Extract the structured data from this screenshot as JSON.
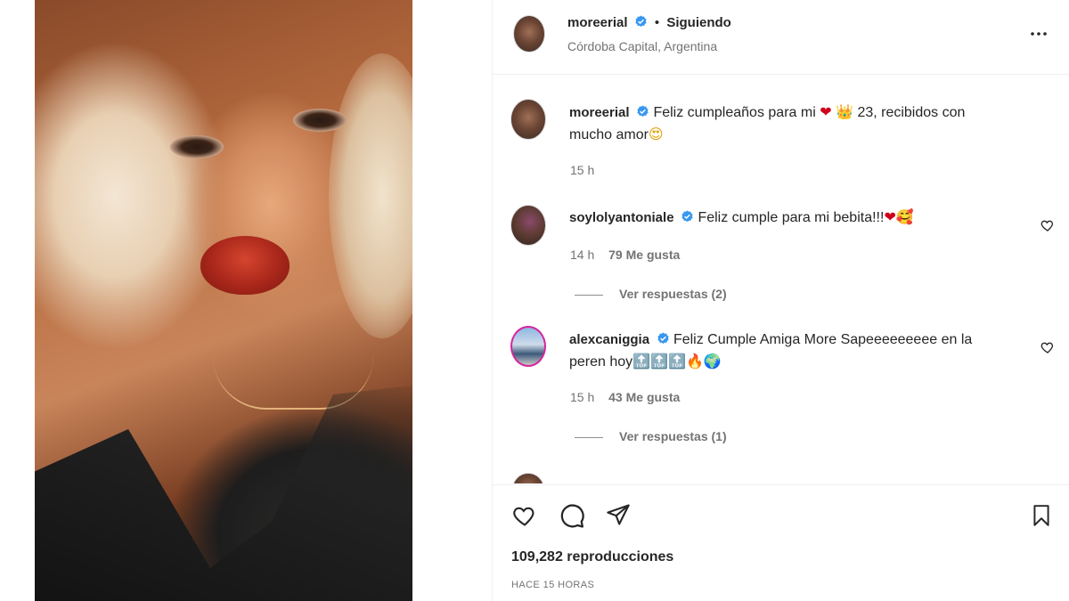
{
  "post": {
    "author": "moreerial",
    "follow_label": "Siguiendo",
    "follow_dot": "•",
    "location": "Córdoba Capital, Argentina",
    "more_label": "•••"
  },
  "caption": {
    "user": "moreerial",
    "text": "Feliz cumpleaños para mi",
    "emoji_1": "❤",
    "emoji_2": "👑",
    "text_2": "23, recibidos con",
    "text_3": "mucho amor",
    "emoji_3": "😍",
    "time": "15 h"
  },
  "comments": [
    {
      "user": "soylolyantoniale",
      "text": "Feliz cumple para mi bebita!!!",
      "emoji": "❤🥰",
      "time": "14 h",
      "likes": "79 Me gusta",
      "replies": "Ver respuestas (2)"
    },
    {
      "user": "alexcaniggia",
      "text": "Feliz Cumple Amiga More Sapeeeeeeeee en la",
      "text_2": "peren hoy",
      "emoji": "🔝🔝🔝🔥🌍",
      "time": "15 h",
      "likes": "43 Me gusta",
      "replies": "Ver respuestas (1)"
    }
  ],
  "stats": {
    "views": "109,282 reproducciones",
    "posted": "HACE 15 HORAS"
  },
  "icons": {
    "like": "heart-icon",
    "comment": "comment-icon",
    "share": "send-icon",
    "save": "bookmark-icon",
    "verified": "verified-badge-icon"
  },
  "colors": {
    "verified": "#3897f0",
    "text": "#262626",
    "secondary": "#737373",
    "story_ring": "#d6249f"
  }
}
